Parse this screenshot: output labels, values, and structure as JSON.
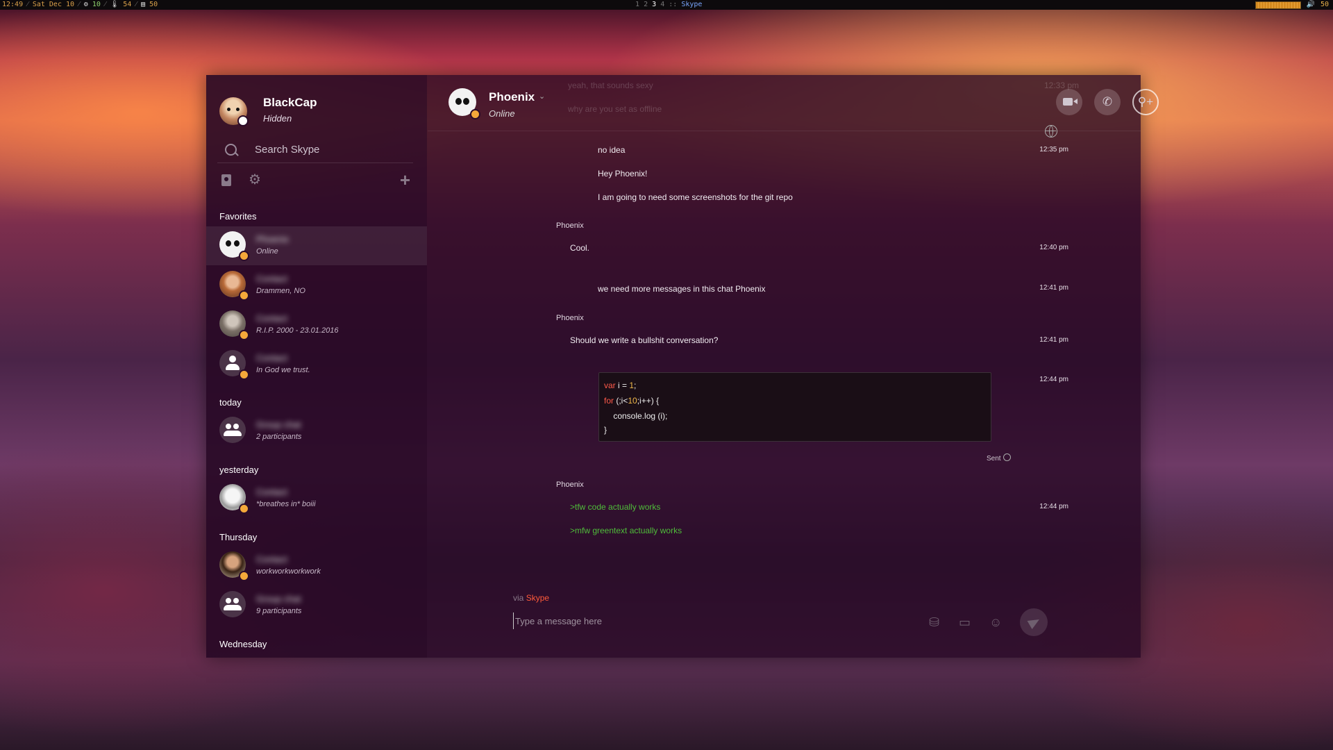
{
  "statusbar": {
    "time": "12:49",
    "date": "Sat Dec 10",
    "cpu": "10",
    "temp": "54",
    "mem": "50",
    "workspaces": [
      "1",
      "2",
      "3",
      "4"
    ],
    "active_app": "Skype",
    "volume": "50"
  },
  "profile": {
    "name": "BlackCap",
    "status": "Hidden"
  },
  "search": {
    "placeholder": "Search Skype"
  },
  "sections": {
    "favorites": "Favorites",
    "today": "today",
    "yesterday": "yesterday",
    "thursday": "Thursday",
    "wednesday": "Wednesday"
  },
  "contacts": [
    {
      "name": "Phoenix",
      "mood": "Online"
    },
    {
      "name": "Contact",
      "mood": "Drammen, NO"
    },
    {
      "name": "Contact",
      "mood": "R.I.P. 2000 - 23.01.2016"
    },
    {
      "name": "Contact",
      "mood": "In God we trust."
    },
    {
      "name": "Group chat",
      "mood": "2 participants"
    },
    {
      "name": "Contact",
      "mood": "*breathes in* boiii"
    },
    {
      "name": "Contact",
      "mood": "workworkworkwork"
    },
    {
      "name": "Group chat",
      "mood": "9 participants"
    }
  ],
  "chat": {
    "name": "Phoenix",
    "status": "Online",
    "ghost1": "yeah, that sounds sexy",
    "ghost2": "why are you set as offline",
    "ghost_time": "12:33 pm",
    "messages": [
      {
        "text": "no idea",
        "time": "12:35 pm"
      },
      {
        "text": "Hey Phoenix!"
      },
      {
        "text": "I am going to need some screenshots for the git repo"
      },
      {
        "sender": "Phoenix",
        "text": "Cool.",
        "time": "12:40 pm"
      },
      {
        "text": "we need more messages in this chat Phoenix",
        "time": "12:41 pm"
      },
      {
        "sender": "Phoenix",
        "text": "Should we write a bullshit conversation?",
        "time": "12:41 pm"
      },
      {
        "time": "12:44 pm"
      },
      {
        "sender": "Phoenix",
        "text": ">tfw code actually works",
        "time": "12:44 pm"
      },
      {
        "text": ">mfw greentext actually works"
      }
    ],
    "sent_label": "Sent",
    "via_prefix": "via",
    "via_app": "Skype",
    "compose_placeholder": "Type a message here"
  }
}
